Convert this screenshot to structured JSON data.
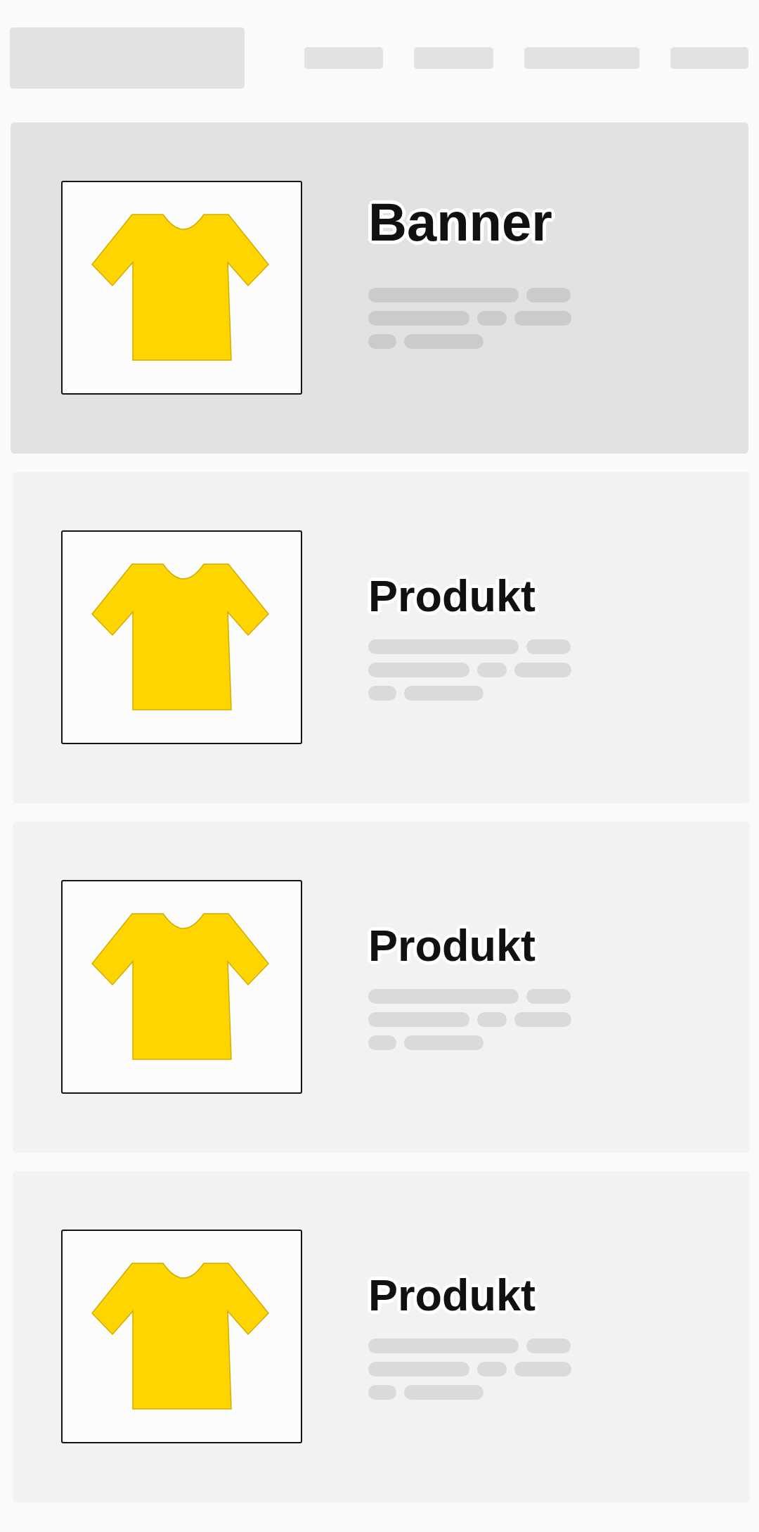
{
  "cards": [
    {
      "kind": "banner",
      "title": "Banner"
    },
    {
      "kind": "product",
      "title": "Produkt"
    },
    {
      "kind": "product",
      "title": "Produkt"
    },
    {
      "kind": "product",
      "title": "Produkt"
    }
  ]
}
